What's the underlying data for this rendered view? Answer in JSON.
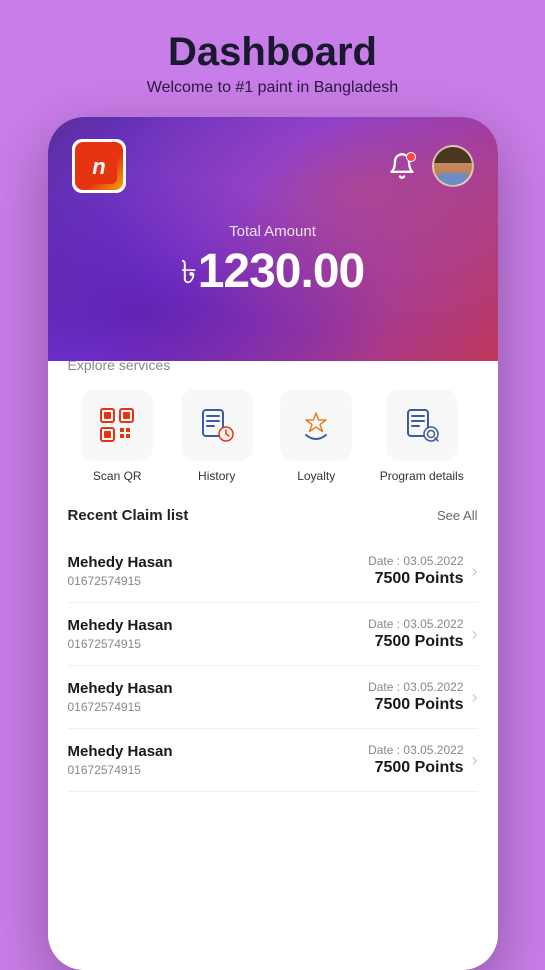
{
  "header": {
    "title": "Dashboard",
    "subtitle": "Welcome to #1 paint in Bangladesh"
  },
  "app": {
    "logo_letter": "n",
    "total_amount_label": "Total Amount",
    "total_amount": "1230.00",
    "currency_symbol": "৳"
  },
  "services": {
    "label": "Explore services",
    "items": [
      {
        "id": "scan-qr",
        "label": "Scan QR",
        "icon": "qr"
      },
      {
        "id": "history",
        "label": "History",
        "icon": "history"
      },
      {
        "id": "loyalty",
        "label": "Loyalty",
        "icon": "loyalty"
      },
      {
        "id": "program-details",
        "label": "Program details",
        "icon": "program"
      }
    ]
  },
  "recent_claims": {
    "title": "Recent Claim list",
    "see_all": "See All",
    "items": [
      {
        "name": "Mehedy Hasan",
        "phone": "01672574915",
        "date": "Date : 03.05.2022",
        "points": "7500 Points"
      },
      {
        "name": "Mehedy Hasan",
        "phone": "01672574915",
        "date": "Date : 03.05.2022",
        "points": "7500 Points"
      },
      {
        "name": "Mehedy Hasan",
        "phone": "01672574915",
        "date": "Date : 03.05.2022",
        "points": "7500 Points"
      },
      {
        "name": "Mehedy Hasan",
        "phone": "01672574915",
        "date": "Date : 03.05.2022",
        "points": "7500 Points"
      }
    ]
  }
}
